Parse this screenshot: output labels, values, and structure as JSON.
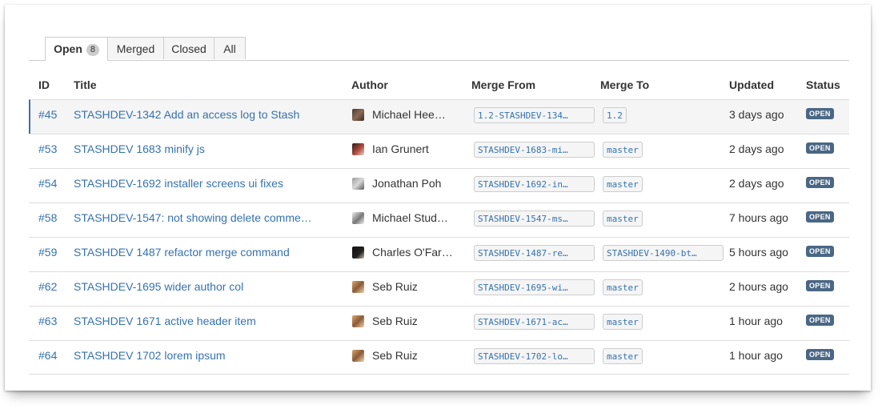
{
  "tabs": [
    {
      "label": "Open",
      "count": "8",
      "active": true
    },
    {
      "label": "Merged",
      "active": false
    },
    {
      "label": "Closed",
      "active": false
    },
    {
      "label": "All",
      "active": false
    }
  ],
  "columns": {
    "id": "ID",
    "title": "Title",
    "author": "Author",
    "merge_from": "Merge From",
    "merge_to": "Merge To",
    "updated": "Updated",
    "status": "Status"
  },
  "rows": [
    {
      "id": "#45",
      "title": "STASHDEV-1342 Add an access log to Stash",
      "author": "Michael Hee…",
      "from": "1.2-STASHDEV-134…",
      "to": "1.2",
      "updated": "3 days ago",
      "status": "OPEN"
    },
    {
      "id": "#53",
      "title": "STASHDEV 1683 minify js",
      "author": "Ian Grunert",
      "from": "STASHDEV-1683-mi…",
      "to": "master",
      "updated": "2 days ago",
      "status": "OPEN"
    },
    {
      "id": "#54",
      "title": "STASHDEV-1692 installer screens ui fixes",
      "author": "Jonathan Poh",
      "from": "STASHDEV-1692-in…",
      "to": "master",
      "updated": "2 days ago",
      "status": "OPEN"
    },
    {
      "id": "#58",
      "title": "STASHDEV-1547: not showing delete comme…",
      "author": "Michael Stud…",
      "from": "STASHDEV-1547-ms…",
      "to": "master",
      "updated": "7 hours ago",
      "status": "OPEN"
    },
    {
      "id": "#59",
      "title": "STASHDEV 1487 refactor merge command",
      "author": "Charles O'Far…",
      "from": "STASHDEV-1487-re…",
      "to": "STASHDEV-1490-bt…",
      "updated": "5 hours ago",
      "status": "OPEN"
    },
    {
      "id": "#62",
      "title": "STASHDEV-1695 wider author col",
      "author": "Seb Ruiz",
      "from": "STASHDEV-1695-wi…",
      "to": "master",
      "updated": "2 hours ago",
      "status": "OPEN"
    },
    {
      "id": "#63",
      "title": "STASHDEV 1671 active header item",
      "author": "Seb Ruiz",
      "from": "STASHDEV-1671-ac…",
      "to": "master",
      "updated": "1 hour ago",
      "status": "OPEN"
    },
    {
      "id": "#64",
      "title": "STASHDEV 1702 lorem ipsum",
      "author": "Seb Ruiz",
      "from": "STASHDEV-1702-lo…",
      "to": "master",
      "updated": "1 hour ago",
      "status": "OPEN"
    }
  ],
  "colors": {
    "link": "#3572b0",
    "lozenge_bg": "#4a6785",
    "selected_row_bg": "#f5f5f5",
    "selected_row_border": "#3572b0",
    "branch_bg": "#f5f5f5",
    "border": "#dddddd"
  }
}
